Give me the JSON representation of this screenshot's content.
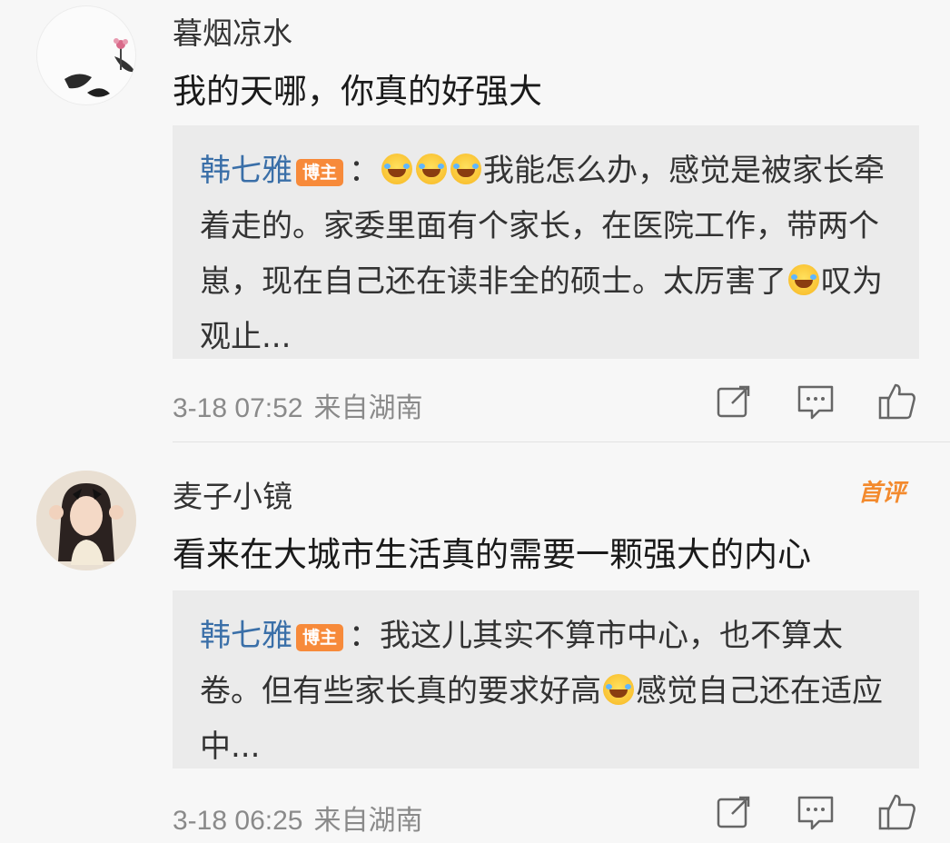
{
  "comments": [
    {
      "username": "暮烟凉水",
      "content": "我的天哪，你真的好强大",
      "reply": {
        "name": "韩七雅",
        "badge": "博主",
        "sep": "：",
        "text_a": "我能怎么办，感觉是被家长牵着走的。家委里面有个家长，在医院工作，带两个崽，现在自己还在读非全的硕士。太厉害了",
        "text_b": "叹为观止..."
      },
      "date": "3-18 07:52",
      "location": "来自湖南"
    },
    {
      "username": "麦子小镜",
      "badge_first": "首评",
      "content": "看来在大城市生活真的需要一颗强大的内心",
      "reply": {
        "name": "韩七雅",
        "badge": "博主",
        "sep": "：",
        "text_a": "我这儿其实不算市中心，也不算太卷。但有些家长真的要求好高",
        "text_b": "感觉自己还在适应中..."
      },
      "date": "3-18 06:25",
      "location": "来自湖南"
    }
  ],
  "icons": {
    "share": "share-icon",
    "reply": "comment-icon",
    "like": "thumbs-up-icon",
    "emoji": "laughing-tears-emoji"
  },
  "colors": {
    "username_link": "#3a6fa8",
    "badge": "#f78a3a",
    "first_badge": "#f38a2d",
    "meta": "#8a8a8a"
  }
}
